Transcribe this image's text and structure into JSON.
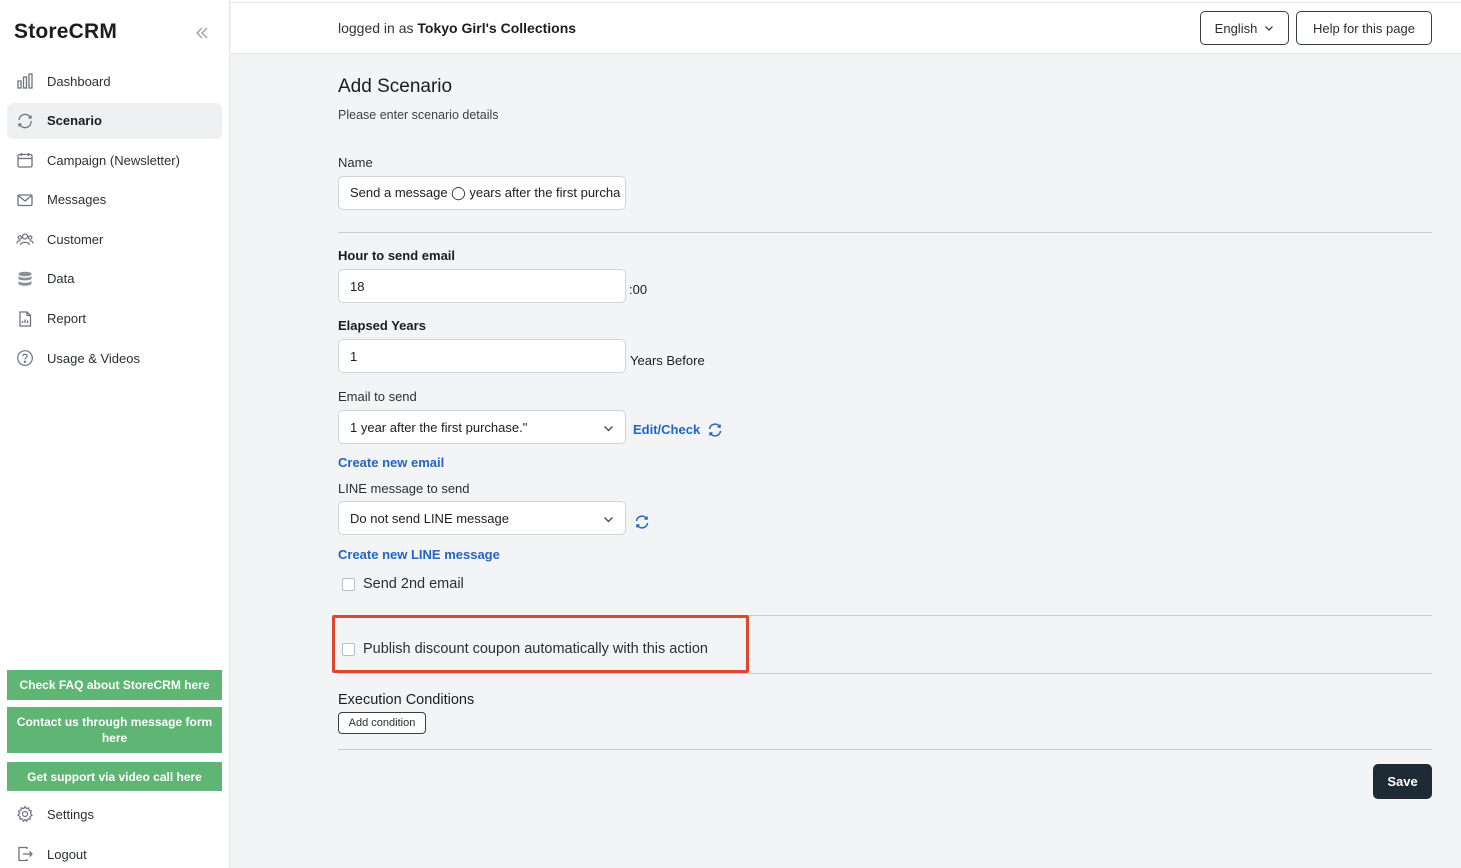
{
  "brand": {
    "logo": "StoreCRM"
  },
  "sidebar": {
    "items": [
      {
        "label": "Dashboard",
        "icon": "bar-chart-icon"
      },
      {
        "label": "Scenario",
        "icon": "refresh-icon",
        "active": true
      },
      {
        "label": "Campaign (Newsletter)",
        "icon": "calendar-icon"
      },
      {
        "label": "Messages",
        "icon": "envelope-icon"
      },
      {
        "label": "Customer",
        "icon": "users-icon"
      },
      {
        "label": "Data",
        "icon": "database-icon"
      },
      {
        "label": "Report",
        "icon": "document-icon"
      },
      {
        "label": "Usage & Videos",
        "icon": "question-circle-icon"
      }
    ],
    "help_buttons": {
      "faq": "Check FAQ about StoreCRM here",
      "contact": "Contact us through message form here",
      "video": "Get support via video call here"
    },
    "settings": "Settings",
    "logout": "Logout"
  },
  "header": {
    "logged_prefix": "logged in as",
    "store_name": "Tokyo Girl's Collections",
    "language": "English",
    "help_page": "Help for this page"
  },
  "form": {
    "title": "Add Scenario",
    "subtitle": "Please enter scenario details",
    "name_label": "Name",
    "name_value": "Send a message ◯ years after the first purcha",
    "hour_label": "Hour to send email",
    "hour_value": "18",
    "hour_suffix": ":00",
    "years_label": "Elapsed Years",
    "years_value": "1",
    "years_suffix": "Years Before",
    "email_label": "Email to send",
    "email_selected": "1 year after the first purchase.\"",
    "edit_check": "Edit/Check",
    "create_email": "Create new email",
    "line_label": "LINE message to send",
    "line_selected": "Do not send LINE message",
    "create_line": "Create new LINE message",
    "second_email": "Send 2nd email",
    "coupon": "Publish discount coupon automatically with this action",
    "conditions_title": "Execution Conditions",
    "add_condition": "Add condition",
    "save": "Save"
  },
  "colors": {
    "accent_link": "#2364c8",
    "help_green": "#5fb574",
    "save_dark": "#1f2a37",
    "highlight_red": "#e0452e"
  }
}
